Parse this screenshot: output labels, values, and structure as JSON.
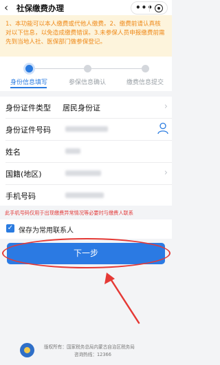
{
  "header": {
    "title": "社保缴费办理",
    "back_glyph": "‹",
    "menu_glyph": "•••"
  },
  "notice": {
    "text": "1、本功能可以本人缴费或代他人缴费。2、缴费前请认真核对以下信息，以免造成缴费错误。3.未参保人员申报缴费前需先到当地人社、医保部门做参保登记。"
  },
  "steps": [
    {
      "label": "身份信息填写",
      "active": true
    },
    {
      "label": "参保信息确认",
      "active": false
    },
    {
      "label": "缴费信息提交",
      "active": false
    }
  ],
  "form": {
    "id_type": {
      "label": "身份证件类型",
      "value": "居民身份证"
    },
    "id_number": {
      "label": "身份证件号码"
    },
    "name": {
      "label": "姓名"
    },
    "nationality": {
      "label": "国籍(地区)"
    },
    "phone": {
      "label": "手机号码"
    }
  },
  "warning": "此手机号码仅用于出现缴费异常情况等必要时与缴费人联系",
  "save_contact": {
    "label": "保存为常用联系人",
    "checked": true
  },
  "next_button": {
    "label": "下一步"
  },
  "footer": {
    "copyright": "版权所有：国家税务总局内蒙古自治区税务局",
    "hotline": "咨询热线：12366"
  },
  "colors": {
    "accent": "#2b7ae3",
    "annotation": "#e53935",
    "notice_text": "#ef8a1a",
    "notice_bg": "#fdf4dc",
    "warning": "#e23b3b"
  },
  "icons": [
    "back-arrow-icon",
    "more-menu-icon",
    "close-miniapp-icon",
    "chevron-right-icon",
    "person-contact-icon",
    "checkbox-checked-icon",
    "tax-emblem-icon"
  ]
}
